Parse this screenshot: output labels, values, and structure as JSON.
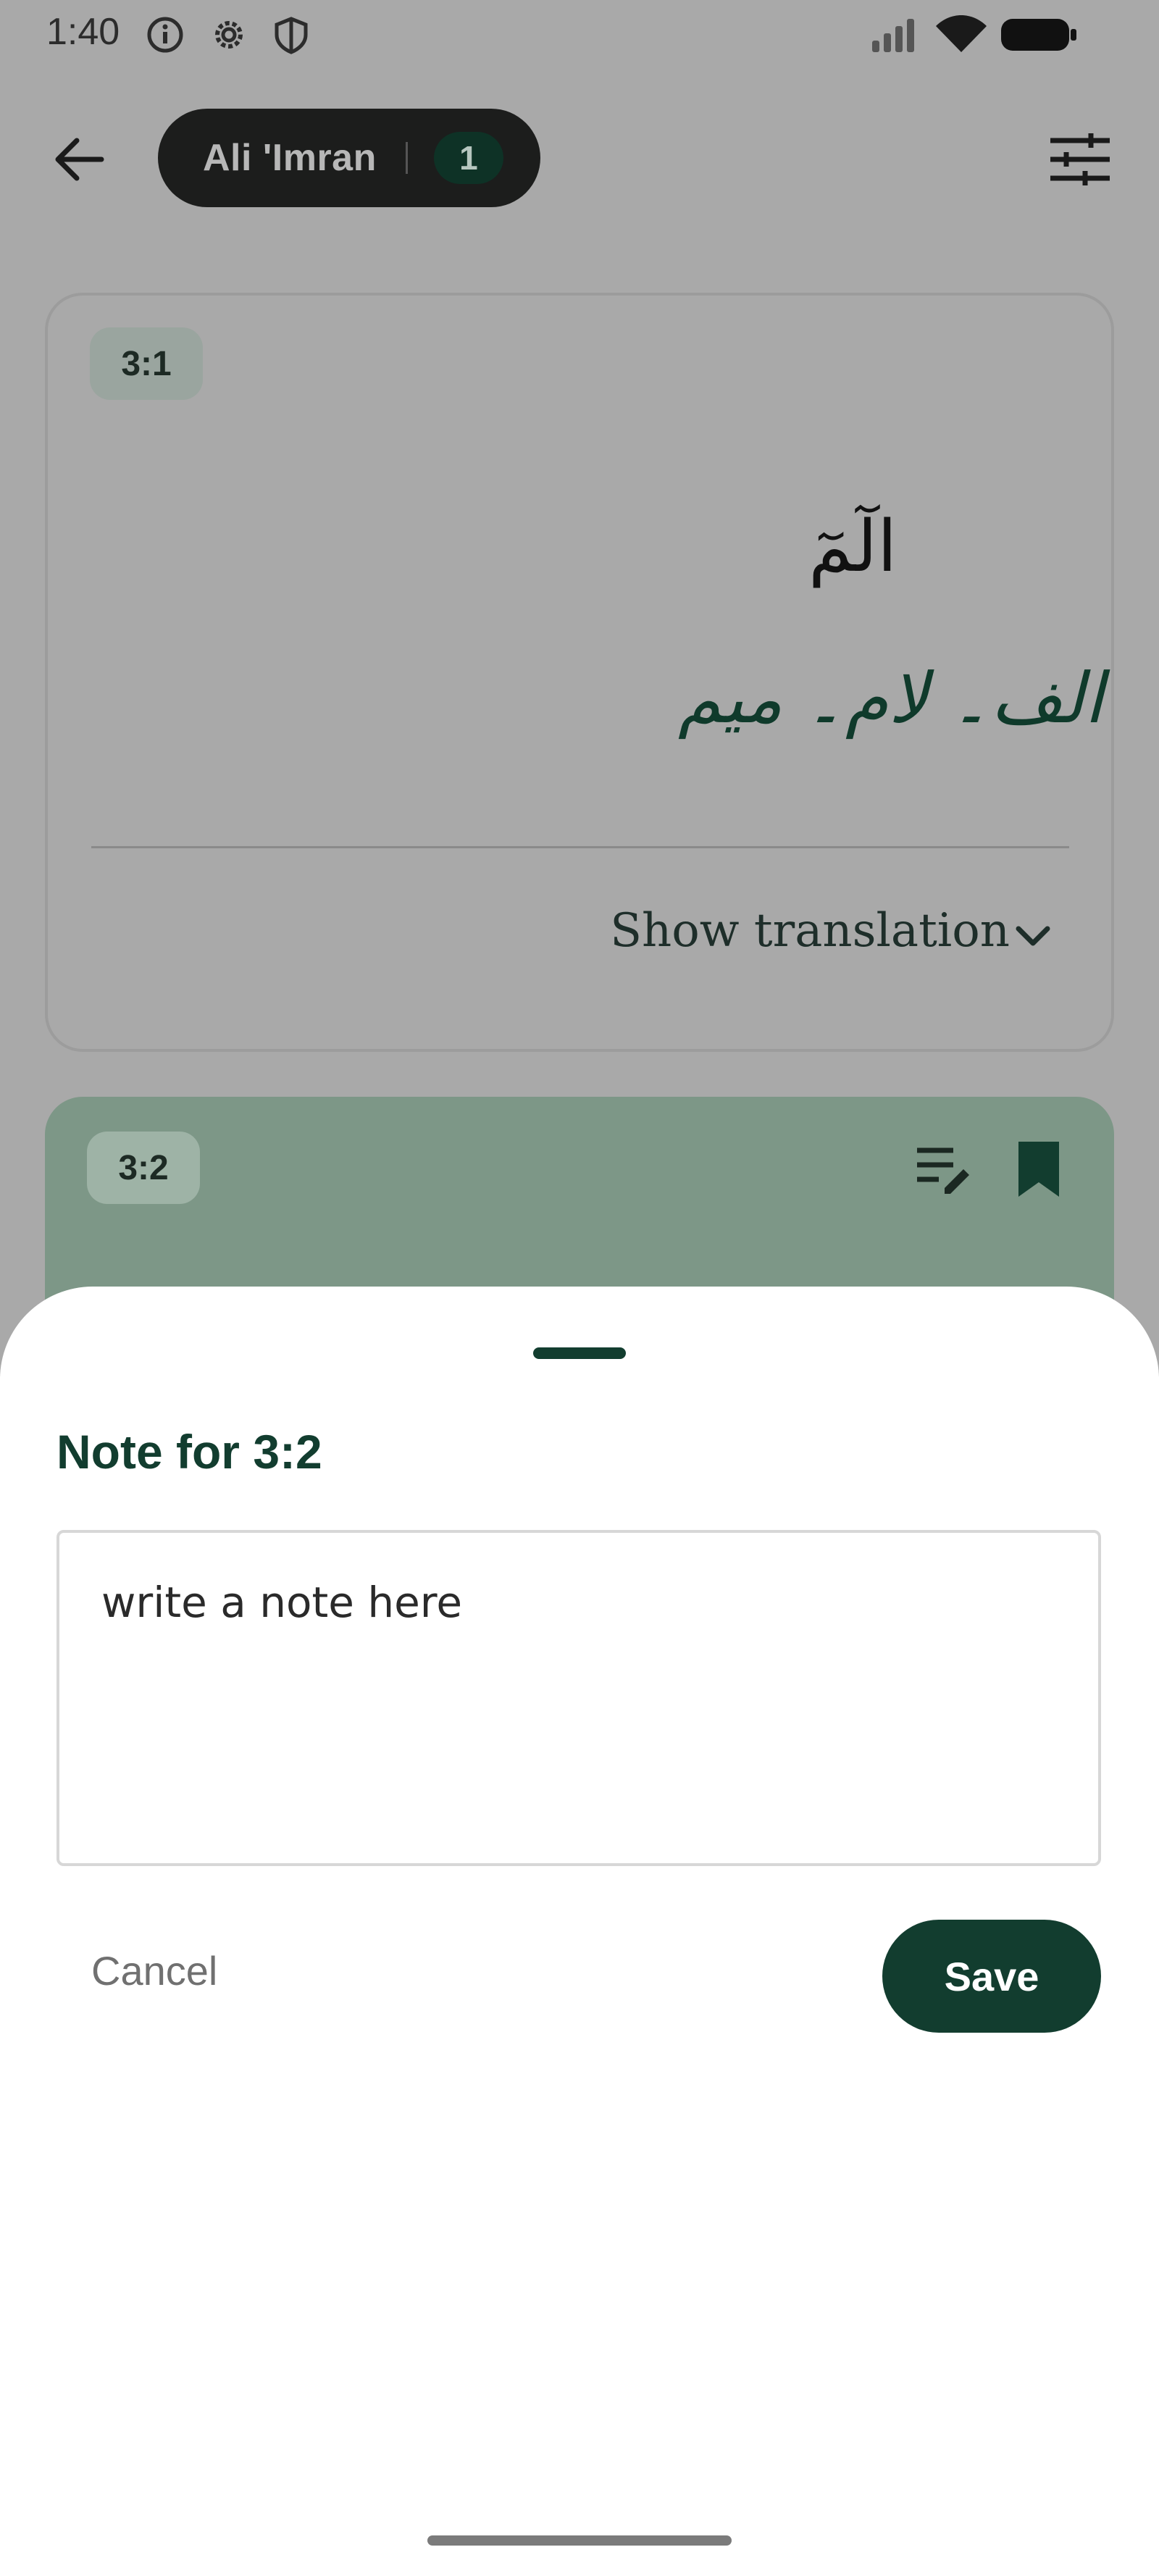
{
  "status_bar": {
    "time": "1:40",
    "icons": [
      "info-icon",
      "settings-gear-icon",
      "shield-icon",
      "signal-icon",
      "wifi-icon",
      "battery-icon"
    ]
  },
  "header": {
    "surah_name": "Ali 'Imran",
    "juz_number": "1",
    "icons": [
      "back-arrow-icon",
      "tune-settings-icon"
    ]
  },
  "verses": [
    {
      "key": "3:1",
      "arabic": "الٓمٓ",
      "translation": "الف۔ لام۔ میم",
      "show_translation_label": "Show translation"
    },
    {
      "key": "3:2",
      "icons": [
        "note-edit-icon",
        "bookmark-icon"
      ]
    }
  ],
  "note_sheet": {
    "title": "Note for 3:2",
    "placeholder": "write a note here",
    "cancel_label": "Cancel",
    "save_label": "Save"
  },
  "colors": {
    "primary": "#123d2f",
    "scrim": "#a9a9a9",
    "highlight_card": "#7d9787"
  }
}
